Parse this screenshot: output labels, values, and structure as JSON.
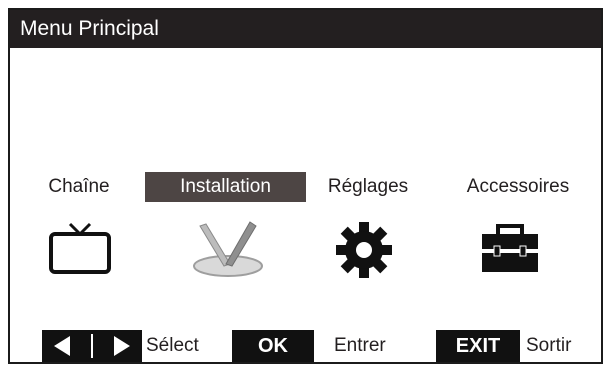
{
  "window": {
    "title": "Menu Principal"
  },
  "menu": {
    "items": [
      {
        "label": "Chaîne",
        "icon": "tv-icon",
        "selected": false
      },
      {
        "label": "Installation",
        "icon": "satellite-dish-icon",
        "selected": true
      },
      {
        "label": "Réglages",
        "icon": "gear-icon",
        "selected": false
      },
      {
        "label": "Accessoires",
        "icon": "toolbox-icon",
        "selected": false
      }
    ]
  },
  "footer": {
    "arrows_icon": "left-right-arrows-icon",
    "select_label": "Sélect",
    "ok_key": "OK",
    "ok_label": "Entrer",
    "exit_key": "EXIT",
    "exit_label": "Sortir"
  },
  "colors": {
    "title_bar": "#231f20",
    "selected_item": "#4d4544",
    "key_background": "#111111",
    "text": "#231f20"
  }
}
